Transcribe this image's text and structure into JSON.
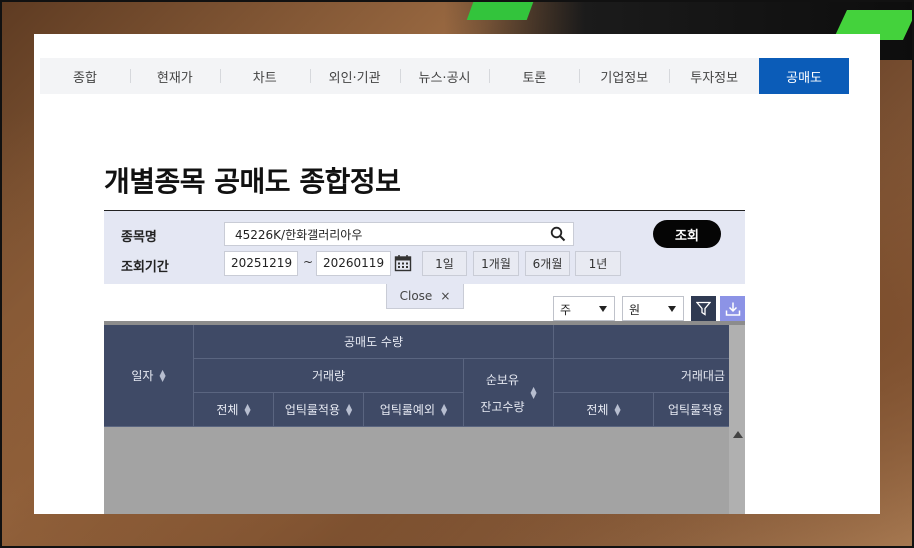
{
  "tabs": [
    {
      "label": "종합"
    },
    {
      "label": "현재가"
    },
    {
      "label": "차트"
    },
    {
      "label": "외인·기관"
    },
    {
      "label": "뉴스·공시"
    },
    {
      "label": "토론"
    },
    {
      "label": "기업정보"
    },
    {
      "label": "투자정보"
    },
    {
      "label": "공매도",
      "active": true
    }
  ],
  "page": {
    "title": "개별종목 공매도 종합정보"
  },
  "search": {
    "name_label": "종목명",
    "name_value": "45226K/한화갤러리아우",
    "period_label": "조회기간",
    "start_date": "20251219",
    "end_date": "20260119",
    "range_sep": "~",
    "query_button": "조회",
    "periods": [
      "1일",
      "1개월",
      "6개월",
      "1년"
    ],
    "close_label": "Close",
    "close_x": "×"
  },
  "filters": {
    "unit_select": "주",
    "currency_select": "원"
  },
  "grid": {
    "col_date": "일자",
    "group_short_volume": "공매도 수량",
    "group_trade_volume": "거래량",
    "col_total": "전체",
    "col_uptick": "업틱룰적용",
    "col_uptick_ex": "업틱룰예외",
    "col_net_balance_1": "순보유",
    "col_net_balance_2": "잔고수량",
    "group_trade_amount": "거래대금",
    "col_amount_total": "전체",
    "col_amount_uptick": "업틱룰적용"
  },
  "colors": {
    "accent": "#0b5cb8",
    "header_bg": "#3f4a66",
    "search_bg": "#e4e7f3"
  }
}
